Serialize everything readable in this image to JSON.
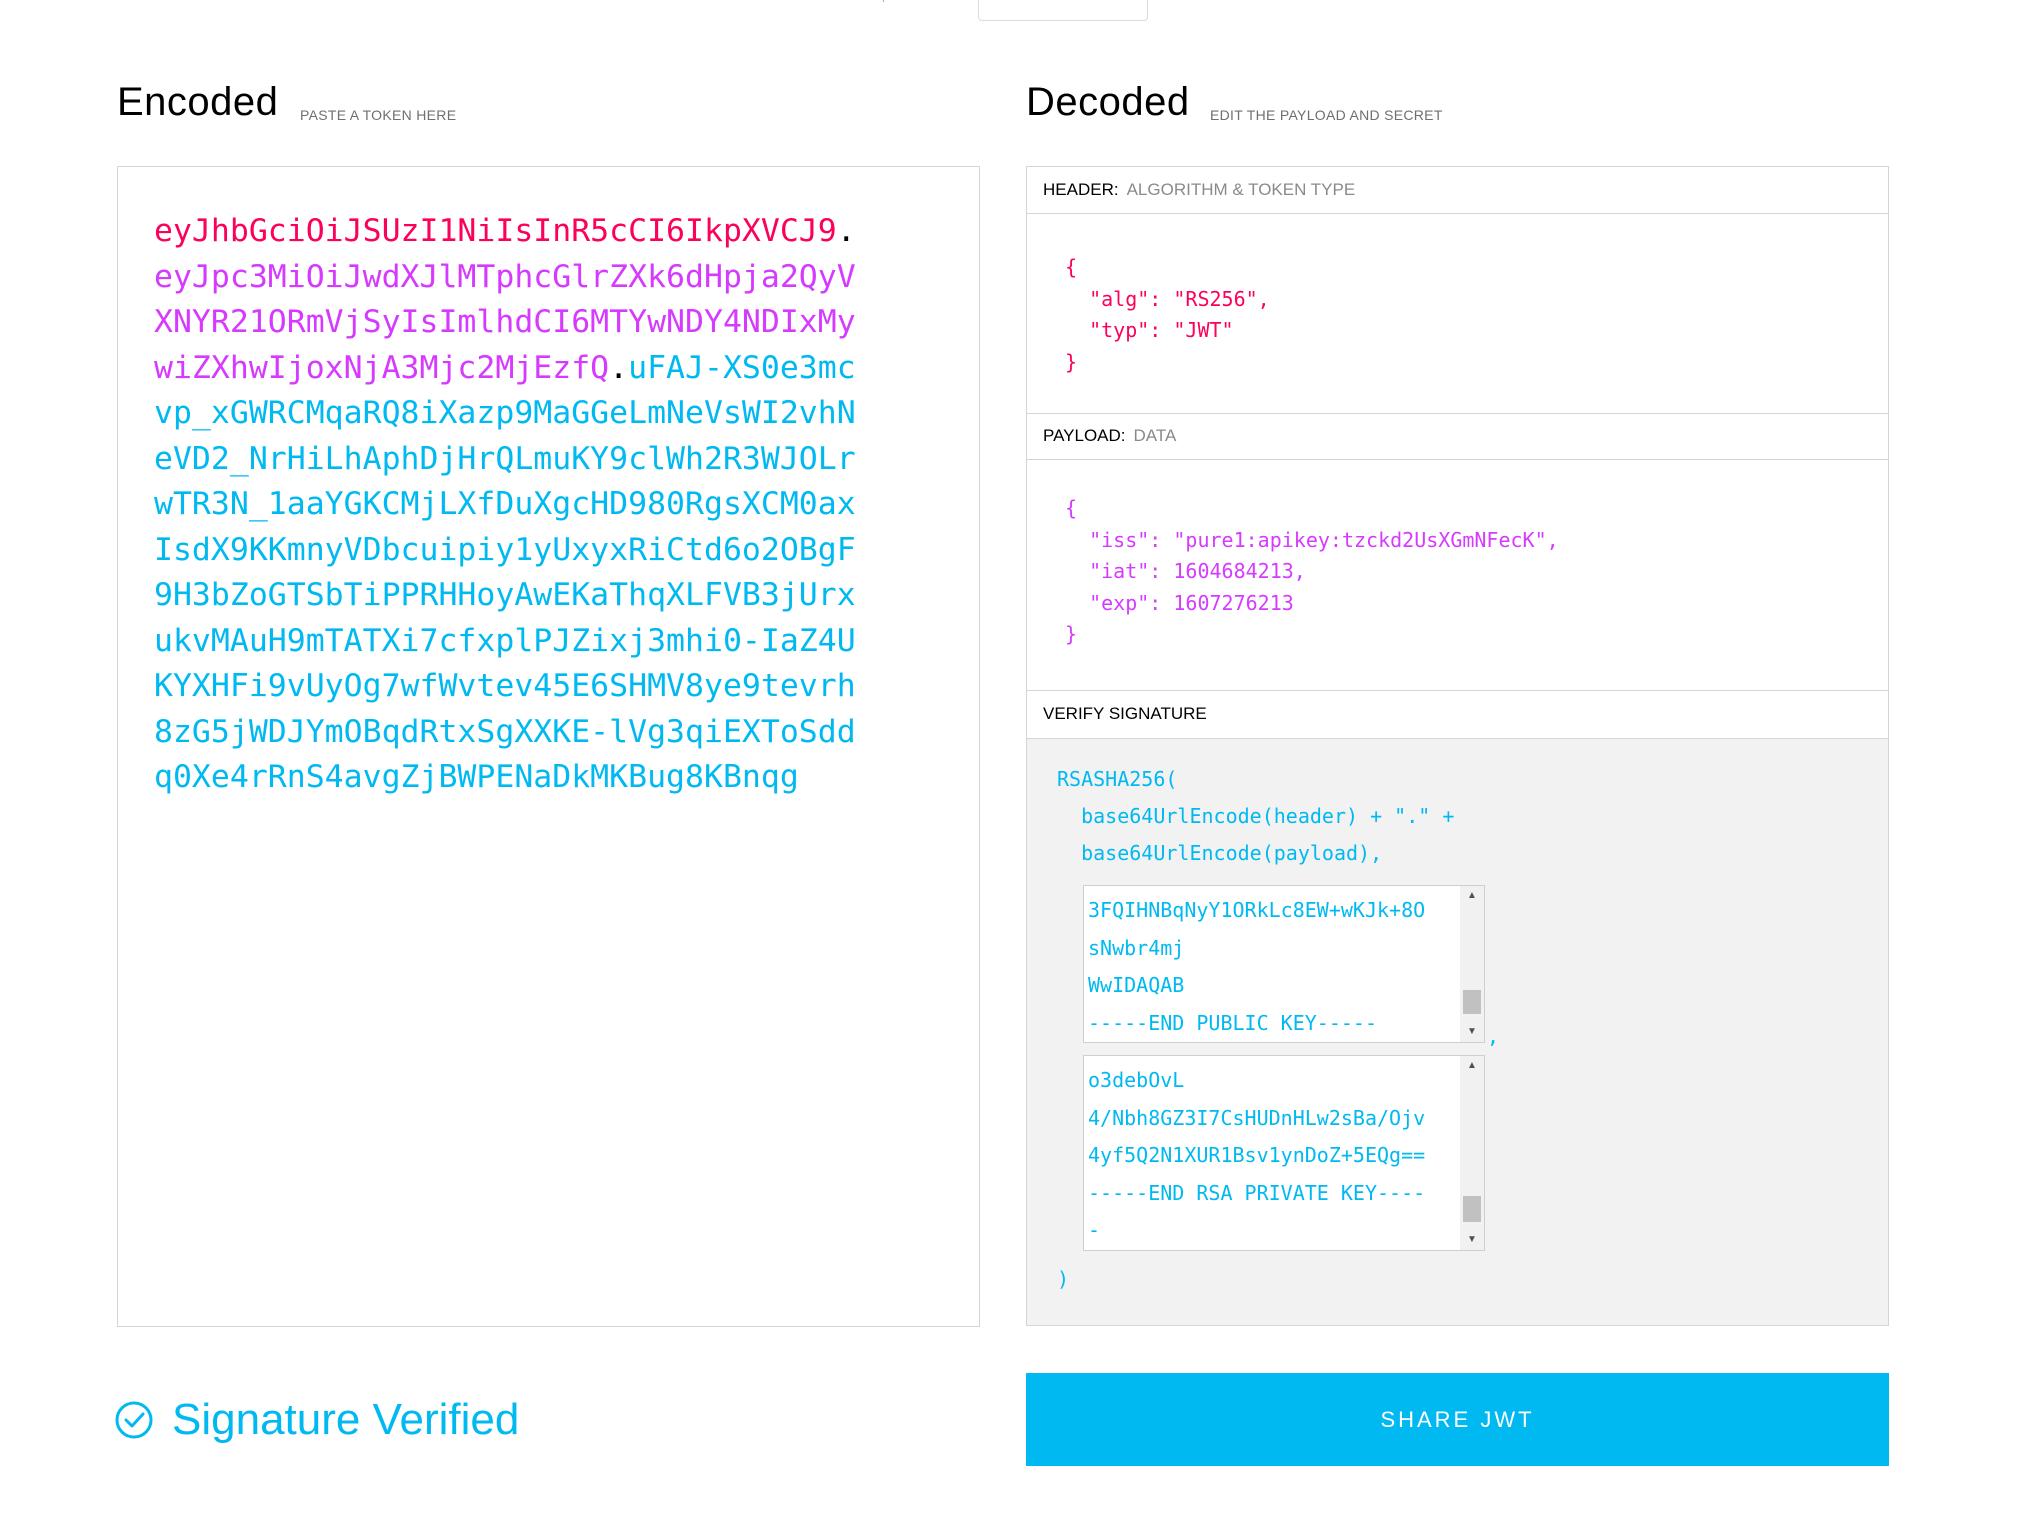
{
  "top_mark": "˙",
  "encoded": {
    "title": "Encoded",
    "subtitle": "PASTE A TOKEN HERE",
    "token_header": "eyJhbGciOiJSUzI1NiIsInR5cCI6IkpXVCJ9",
    "token_payload": "eyJpc3MiOiJwdXJlMTphcGlrZXk6dHpja2QyVXNYR21ORmVjSyIsImlhdCI6MTYwNDY4NDIxMywiZXhwIjoxNjA3Mjc2MjEzfQ",
    "token_signature": "uFAJ-XS0e3mcvp_xGWRCMqaRQ8iXazp9MaGGeLmNeVsWI2vhNeVD2_NrHiLhAphDjHrQLmuKY9clWh2R3WJOLrwTR3N_1aaYGKCMjLXfDuXgcHD980RgsXCM0axIsdX9KKmnyVDbcuipiy1yUxyxRiCtd6o2OBgF9H3bZoGTSbTiPPRHHoyAwEKaThqXLFVB3jUrxukvMAuH9mTATXi7cfxplPJZixj3mhi0-IaZ4UKYXHFi9vUyOg7wfWvtev45E6SHMV8ye9tevrh8zG5jWDJYmOBqdRtxSgXXKE-lVg3qiEXToSddq0Xe4rRnS4avgZjBWPENaDkMKBug8KBnqg",
    "dot": "."
  },
  "decoded": {
    "title": "Decoded",
    "subtitle": "EDIT THE PAYLOAD AND SECRET",
    "header_panel": {
      "label": "HEADER:",
      "sub": "ALGORITHM & TOKEN TYPE",
      "json": "{\n  \"alg\": \"RS256\",\n  \"typ\": \"JWT\"\n}"
    },
    "payload_panel": {
      "label": "PAYLOAD:",
      "sub": "DATA",
      "json": "{\n  \"iss\": \"pure1:apikey:tzckd2UsXGmNFecK\",\n  \"iat\": 1604684213,\n  \"exp\": 1607276213\n}"
    },
    "verify_panel": {
      "label": "VERIFY SIGNATURE",
      "code_open": "RSASHA256(\n  base64UrlEncode(header) + \".\" +\n  base64UrlEncode(payload),",
      "public_key_lines": "3FQIHNBqNyY1ORkLc8EW+wKJk+8O\nsNwbr4mj\nWwIDAQAB\n-----END PUBLIC KEY-----",
      "comma": ",",
      "private_key_lines": "o3debOvL\n4/Nbh8GZ3I7CsHUDnHLw2sBa/Ojv\n4yf5Q2N1XUR1Bsv1ynDoZ+5EQg==\n-----END RSA PRIVATE KEY----\n-",
      "code_close": ")"
    }
  },
  "status": {
    "text": "Signature Verified",
    "color": "#00b9f1",
    "icon": "check-circle-icon"
  },
  "share_button": {
    "label": "SHARE JWT",
    "color": "#00b9f1"
  }
}
